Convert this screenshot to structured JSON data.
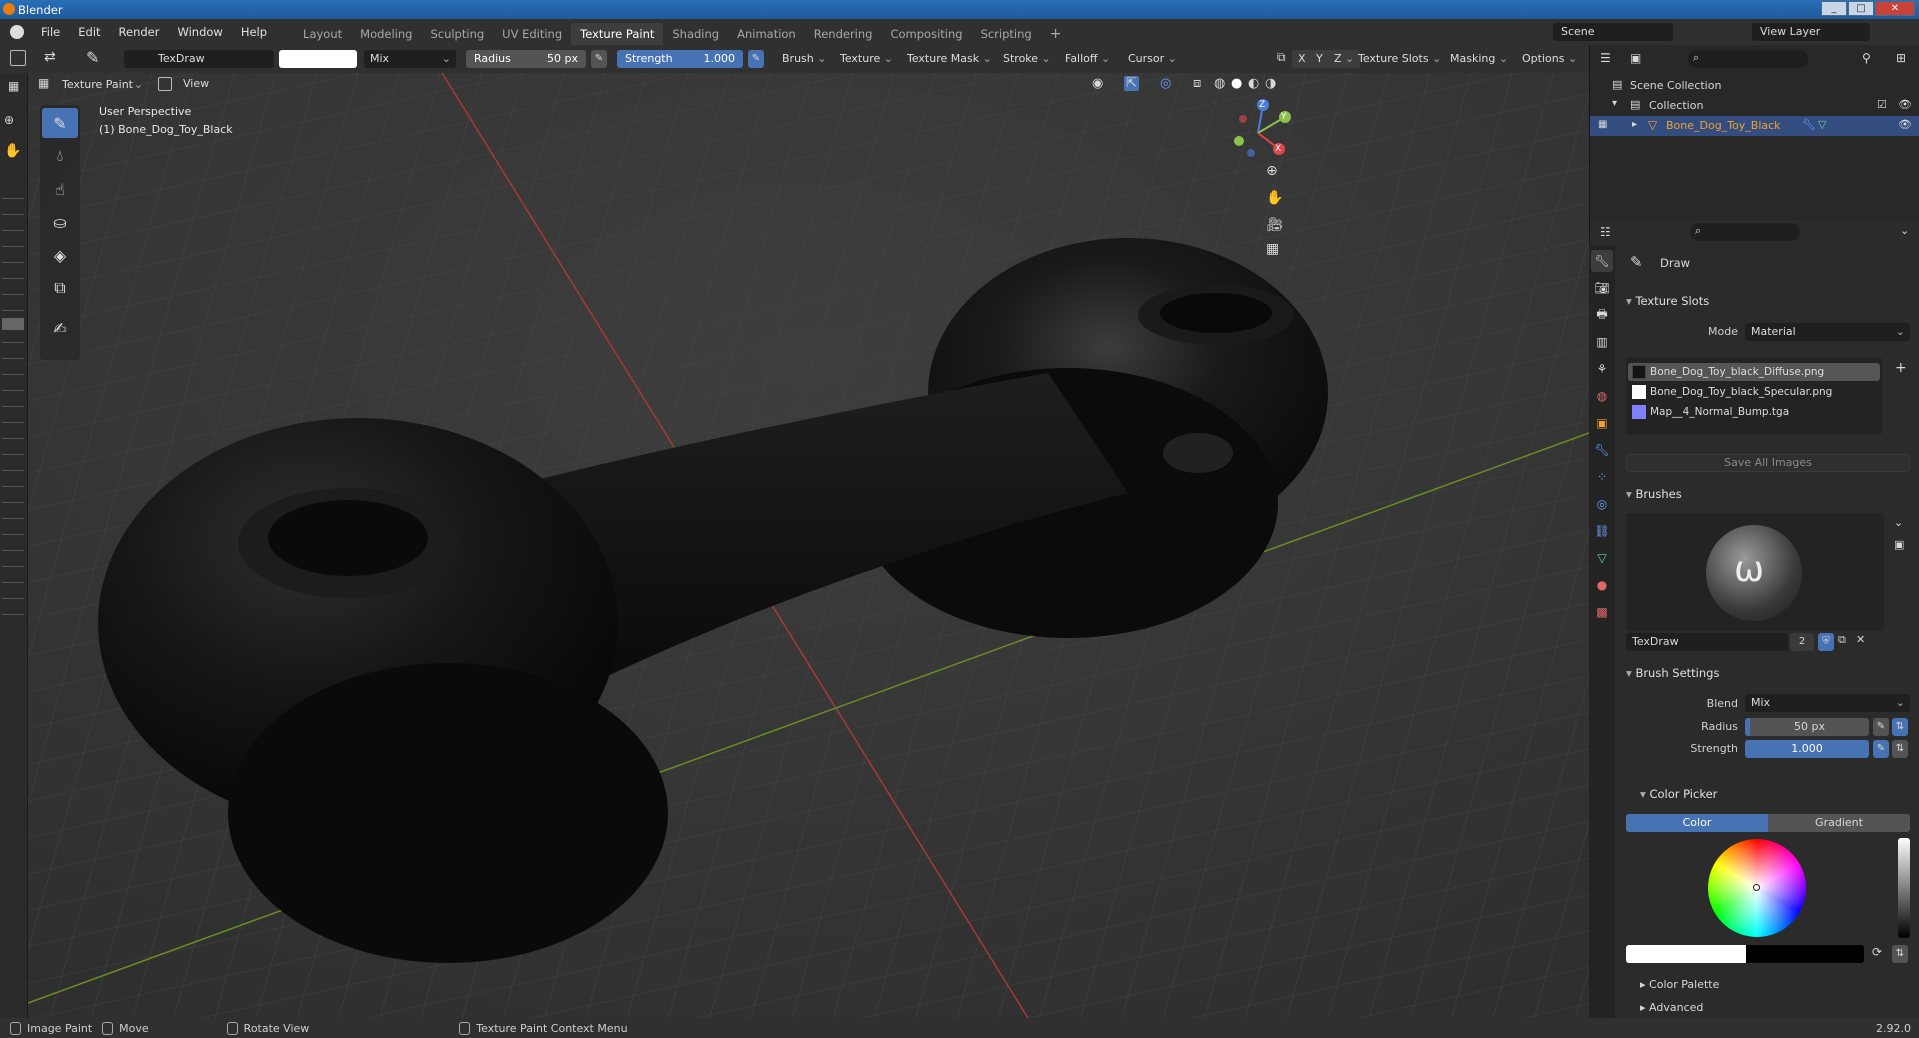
{
  "window": {
    "title": "Blender",
    "controls": [
      "_",
      "□",
      "✕"
    ]
  },
  "menubar": {
    "menus": [
      "File",
      "Edit",
      "Render",
      "Window",
      "Help"
    ],
    "workspaces": [
      "Layout",
      "Modeling",
      "Sculpting",
      "UV Editing",
      "Texture Paint",
      "Shading",
      "Animation",
      "Rendering",
      "Compositing",
      "Scripting"
    ],
    "active_workspace": "Texture Paint",
    "scene": "Scene",
    "view_layer": "View Layer"
  },
  "tool_header": {
    "brush_name": "TexDraw",
    "blend": "Mix",
    "radius_label": "Radius",
    "radius_value": "50 px",
    "strength_label": "Strength",
    "strength_value": "1.000",
    "menus": [
      "Brush",
      "Texture",
      "Texture Mask",
      "Stroke",
      "Falloff",
      "Cursor"
    ],
    "axis": [
      "X",
      "Y",
      "Z"
    ],
    "right_menus": [
      "Texture Slots",
      "Masking",
      "Options"
    ]
  },
  "view_header": {
    "mode": "Texture Paint",
    "view_menu": "View"
  },
  "viewport": {
    "perspective": "User Perspective",
    "object_label": "(1) Bone_Dog_Toy_Black",
    "gizmo": {
      "z": "Z",
      "y": "Y",
      "x": "X"
    }
  },
  "outliner": {
    "scene_collection": "Scene Collection",
    "collection": "Collection",
    "object": "Bone_Dog_Toy_Black"
  },
  "properties": {
    "tool_name": "Draw",
    "texture_slots": {
      "title": "Texture Slots",
      "mode_label": "Mode",
      "mode_value": "Material",
      "slots": [
        {
          "name": "Bone_Dog_Toy_black_Diffuse.png",
          "color": "#151515"
        },
        {
          "name": "Bone_Dog_Toy_black_Specular.png",
          "color": "#ffffff"
        },
        {
          "name": "Map__4_Normal_Bump.tga",
          "color": "#8080ff"
        }
      ],
      "save_all": "Save All Images"
    },
    "brushes": {
      "title": "Brushes",
      "brush_name": "TexDraw",
      "users": "2"
    },
    "brush_settings": {
      "title": "Brush Settings",
      "blend_label": "Blend",
      "blend_value": "Mix",
      "radius_label": "Radius",
      "radius_value": "50 px",
      "strength_label": "Strength",
      "strength_value": "1.000",
      "color_picker": "Color Picker",
      "color_tab": "Color",
      "gradient_tab": "Gradient",
      "color_palette": "Color Palette",
      "advanced": "Advanced"
    }
  },
  "statusbar": {
    "items": [
      "Image Paint",
      "Move",
      "Rotate View",
      "Texture Paint Context Menu"
    ],
    "version": "2.92.0"
  },
  "colors": {
    "accent": "#4772b3",
    "header": "#303030",
    "panel": "#2b2b2b"
  }
}
